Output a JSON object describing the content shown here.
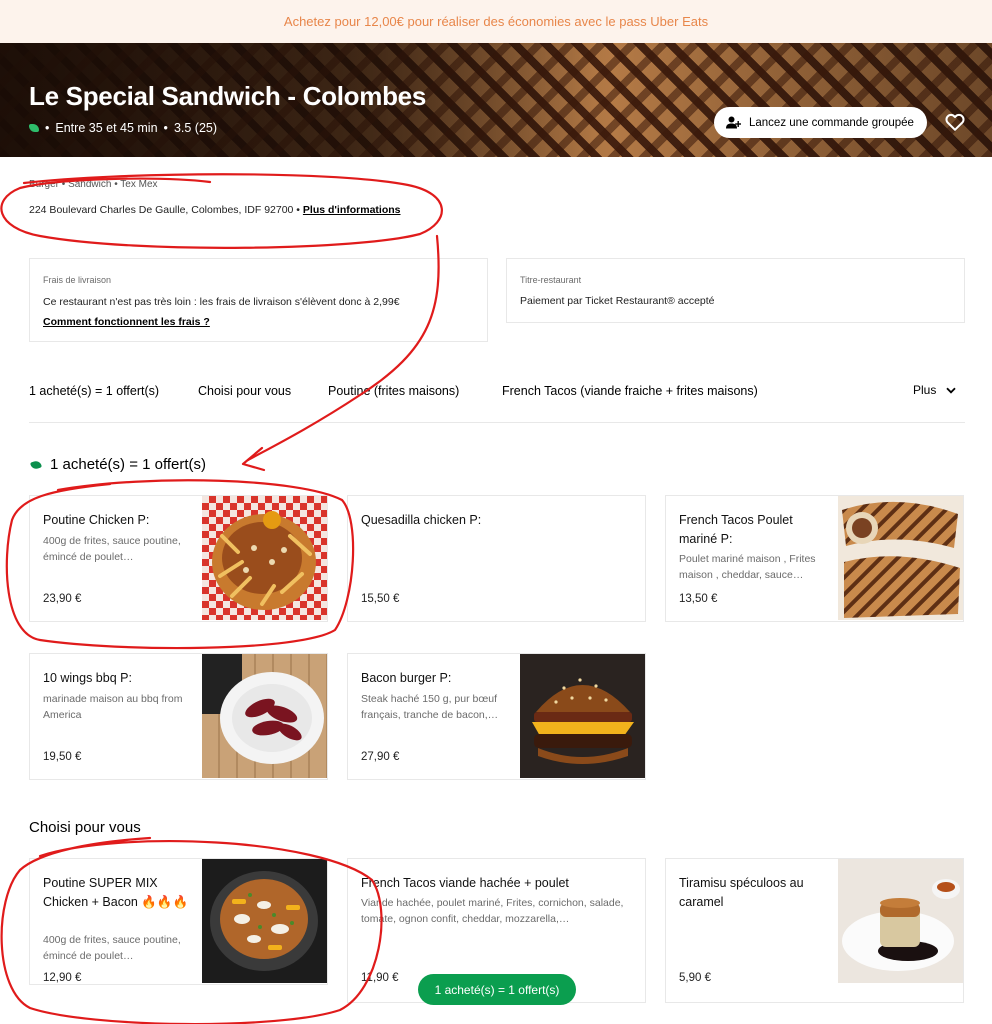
{
  "promo_banner": "Achetez pour 12,00€ pour réaliser des économies avec le pass Uber Eats",
  "hero": {
    "title": "Le Special Sandwich - Colombes",
    "delivery_time": "Entre 35 et 45 min",
    "rating": "3.5 (25)",
    "separator": "•",
    "group_order_label": "Lancez une commande groupée"
  },
  "details": {
    "cuisine": "Burger • Sandwich • Tex Mex",
    "address": "224 Boulevard Charles De Gaulle, Colombes, IDF 92700 •",
    "more_info": "Plus d'informations"
  },
  "info_cards": {
    "delivery": {
      "label": "Frais de livraison",
      "text": "Ce restaurant n'est pas très loin : les frais de livraison s'élèvent donc à 2,99€",
      "link": "Comment fonctionnent les frais ?"
    },
    "voucher": {
      "label": "Titre-restaurant",
      "text": "Paiement par Ticket Restaurant® accepté"
    }
  },
  "tabs": [
    "1 acheté(s) = 1 offert(s)",
    "Choisi pour vous",
    "Poutine (frites maisons)",
    "French Tacos (viande fraiche + frites maisons)"
  ],
  "more_tab": "Plus",
  "section_bogo": {
    "title": "1 acheté(s) = 1 offert(s)",
    "items": [
      {
        "name": "Poutine Chicken P:",
        "desc": "400g de frites, sauce poutine, émincé de poulet…",
        "price": "23,90 €"
      },
      {
        "name": "Quesadilla chicken P:",
        "desc": "",
        "price": "15,50 €"
      },
      {
        "name": "French Tacos Poulet mariné P:",
        "desc": "Poulet mariné maison , Frites maison , cheddar, sauce…",
        "price": "13,50 €"
      },
      {
        "name": "10 wings bbq P:",
        "desc": "marinade maison au bbq from America",
        "price": "19,50 €"
      },
      {
        "name": "Bacon burger P:",
        "desc": "Steak haché 150 g, pur bœuf français, tranche de bacon,…",
        "price": "27,90 €"
      }
    ]
  },
  "section_picked": {
    "title": "Choisi pour vous",
    "items": [
      {
        "name": "Poutine SUPER MIX Chicken + Bacon 🔥🔥🔥",
        "desc": "400g de frites, sauce poutine, émincé de poulet…",
        "price": "12,90 €"
      },
      {
        "name": "French Tacos viande hachée + poulet",
        "desc": "Viande hachée, poulet mariné, Frites, cornichon, salade, tomate, ognon confit, cheddar, mozzarella,…",
        "price": "11,90 €"
      },
      {
        "name": "Tiramisu spéculoos au caramel",
        "desc": "",
        "price": "5,90 €"
      }
    ]
  },
  "floating_button": "1 acheté(s) = 1 offert(s)",
  "colors": {
    "accent_green": "#0b9e4f",
    "promo_text": "#e8864a",
    "annotation_red": "#e01b1b"
  }
}
